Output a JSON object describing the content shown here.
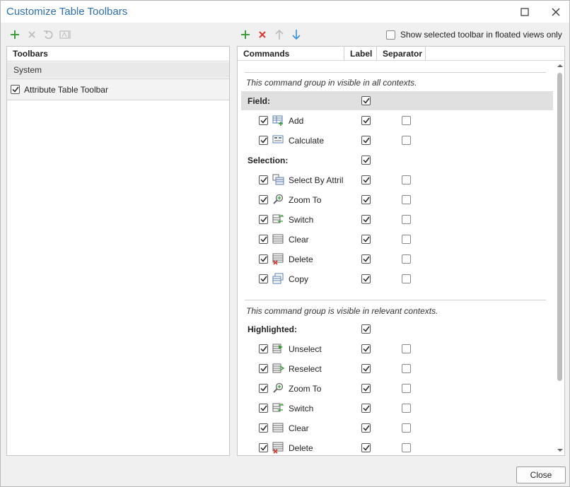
{
  "window": {
    "title": "Customize Table Toolbars"
  },
  "left": {
    "header": "Toolbars",
    "group": "System",
    "toolbar_item": {
      "label": "Attribute Table Toolbar",
      "checked": true
    }
  },
  "right": {
    "float_option": {
      "label": "Show selected toolbar in floated views only",
      "checked": false
    },
    "columns": [
      "Commands",
      "Label",
      "Separator"
    ],
    "section1_note": "This command group in visible in all contexts.",
    "field_group": {
      "label": "Field:",
      "label_checked": true
    },
    "field_items": [
      {
        "label": "Add",
        "icon": "add-field-icon"
      },
      {
        "label": "Calculate",
        "icon": "calculate-field-icon"
      }
    ],
    "selection_group": {
      "label": "Selection:",
      "label_checked": true
    },
    "selection_items": [
      {
        "label": "Select By Attril",
        "icon": "select-by-attributes-icon"
      },
      {
        "label": "Zoom To",
        "icon": "zoom-to-icon"
      },
      {
        "label": "Switch",
        "icon": "switch-selection-icon"
      },
      {
        "label": "Clear",
        "icon": "clear-selection-icon"
      },
      {
        "label": "Delete",
        "icon": "delete-selection-icon"
      },
      {
        "label": "Copy",
        "icon": "copy-selection-icon"
      }
    ],
    "section2_note": "This command group is visible in relevant contexts.",
    "highlighted_group": {
      "label": "Highlighted:",
      "label_checked": true
    },
    "highlighted_items": [
      {
        "label": "Unselect",
        "icon": "unselect-icon"
      },
      {
        "label": "Reselect",
        "icon": "reselect-icon"
      },
      {
        "label": "Zoom To",
        "icon": "zoom-to-icon"
      },
      {
        "label": "Switch",
        "icon": "switch-selection-icon"
      },
      {
        "label": "Clear",
        "icon": "clear-selection-icon"
      },
      {
        "label": "Delete",
        "icon": "delete-selection-icon"
      }
    ]
  },
  "footer": {
    "close_label": "Close"
  },
  "colors": {
    "title": "#2d6fb0",
    "add_green": "#3a9c3a",
    "remove_red": "#d9362b",
    "arrow_blue": "#3b8fd6",
    "highlight_row": "#e0e0e0"
  }
}
